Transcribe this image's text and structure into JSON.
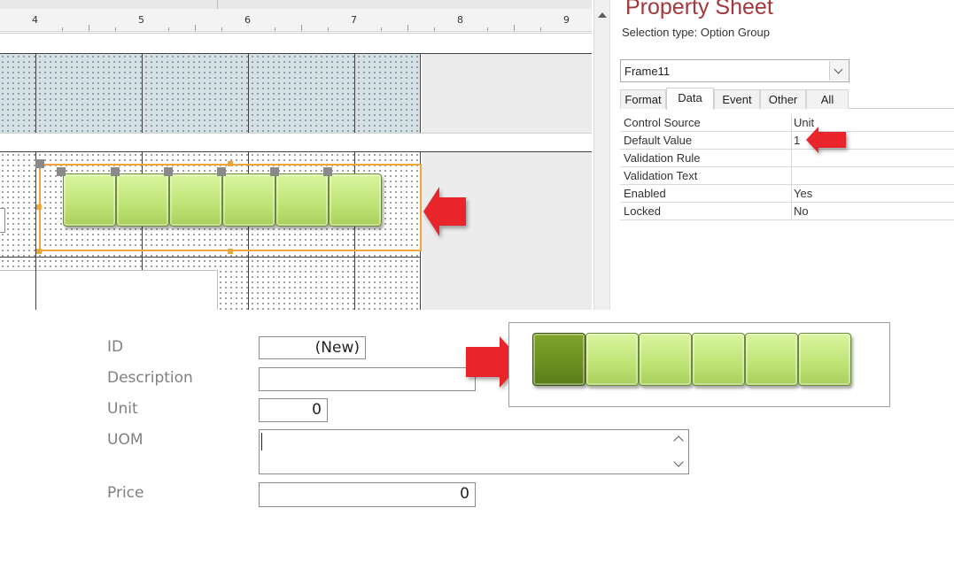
{
  "ruler": {
    "marks": [
      "4",
      "5",
      "6",
      "7",
      "8",
      "9"
    ]
  },
  "property_sheet": {
    "title": "Property Sheet",
    "selection_label": "Selection type:",
    "selection_value": "Option Group",
    "object_combo_value": "Frame11",
    "tabs": [
      "Format",
      "Data",
      "Event",
      "Other",
      "All"
    ],
    "active_tab": "Data",
    "rows": [
      {
        "name": "Control Source",
        "value": "Unit"
      },
      {
        "name": "Default Value",
        "value": "1"
      },
      {
        "name": "Validation Rule",
        "value": ""
      },
      {
        "name": "Validation Text",
        "value": ""
      },
      {
        "name": "Enabled",
        "value": "Yes"
      },
      {
        "name": "Locked",
        "value": "No"
      }
    ]
  },
  "form": {
    "id_label": "ID",
    "id_value": "(New)",
    "description_label": "Description",
    "description_value": "",
    "unit_label": "Unit",
    "unit_value": "0",
    "uom_label": "UOM",
    "uom_value": "",
    "price_label": "Price",
    "price_value": "0"
  },
  "colors": {
    "accent_title": "#a4373a",
    "arrow_red": "#e8252b",
    "option_green": "#c4e87a",
    "option_selected": "#6b8e1f",
    "selection_orange": "#f0a540"
  }
}
